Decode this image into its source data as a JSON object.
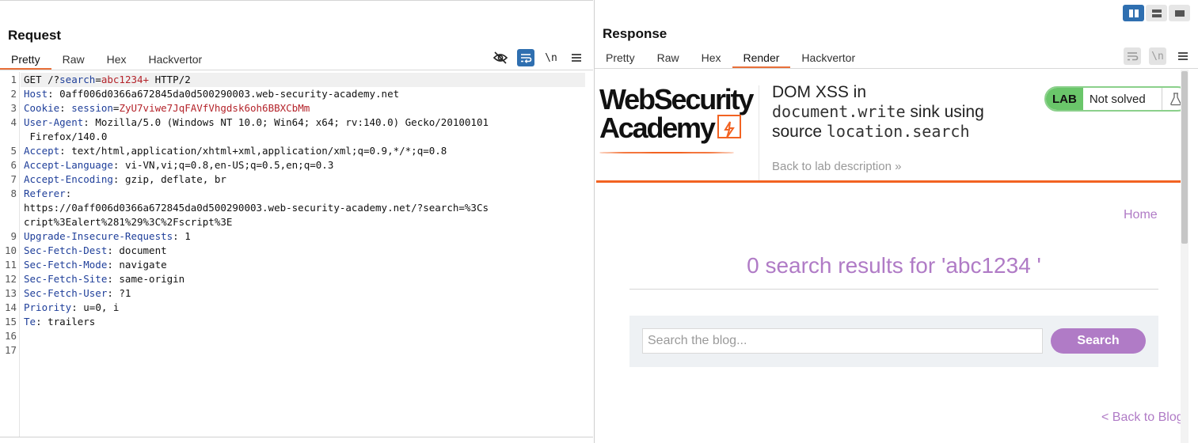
{
  "request": {
    "title": "Request",
    "tabs": [
      "Pretty",
      "Raw",
      "Hex",
      "Hackvertor"
    ],
    "active_tab": "Pretty",
    "toolbar": {
      "newline_label": "\\n"
    },
    "lines": [
      {
        "n": "1",
        "parts": [
          [
            "t",
            "GET /?"
          ],
          [
            "k",
            "search"
          ],
          [
            "t",
            "="
          ],
          [
            "v",
            "abc1234+"
          ],
          [
            "t",
            " HTTP/2"
          ]
        ]
      },
      {
        "n": "2",
        "parts": [
          [
            "k",
            "Host"
          ],
          [
            "t",
            ": 0aff006d0366a672845da0d500290003.web-security-academy.net"
          ]
        ]
      },
      {
        "n": "3",
        "parts": [
          [
            "k",
            "Cookie"
          ],
          [
            "t",
            ": "
          ],
          [
            "k",
            "session"
          ],
          [
            "t",
            "="
          ],
          [
            "v",
            "ZyU7viwe7JqFAVfVhgdsk6oh6BBXCbMm"
          ]
        ]
      },
      {
        "n": "4",
        "parts": [
          [
            "k",
            "User-Agent"
          ],
          [
            "t",
            ": Mozilla/5.0 (Windows NT 10.0; Win64; x64; rv:140.0) Gecko/20100101"
          ]
        ]
      },
      {
        "n": "",
        "parts": [
          [
            "t",
            " Firefox/140.0"
          ]
        ]
      },
      {
        "n": "5",
        "parts": [
          [
            "k",
            "Accept"
          ],
          [
            "t",
            ": text/html,application/xhtml+xml,application/xml;q=0.9,*/*;q=0.8"
          ]
        ]
      },
      {
        "n": "6",
        "parts": [
          [
            "k",
            "Accept-Language"
          ],
          [
            "t",
            ": vi-VN,vi;q=0.8,en-US;q=0.5,en;q=0.3"
          ]
        ]
      },
      {
        "n": "7",
        "parts": [
          [
            "k",
            "Accept-Encoding"
          ],
          [
            "t",
            ": gzip, deflate, br"
          ]
        ]
      },
      {
        "n": "8",
        "parts": [
          [
            "k",
            "Referer"
          ],
          [
            "t",
            ":"
          ]
        ]
      },
      {
        "n": "",
        "parts": [
          [
            "t",
            "https://0aff006d0366a672845da0d500290003.web-security-academy.net/?search=%3Cs"
          ]
        ]
      },
      {
        "n": "",
        "parts": [
          [
            "t",
            "cript%3Ealert%281%29%3C%2Fscript%3E"
          ]
        ]
      },
      {
        "n": "9",
        "parts": [
          [
            "k",
            "Upgrade-Insecure-Requests"
          ],
          [
            "t",
            ": 1"
          ]
        ]
      },
      {
        "n": "10",
        "parts": [
          [
            "k",
            "Sec-Fetch-Dest"
          ],
          [
            "t",
            ": document"
          ]
        ]
      },
      {
        "n": "11",
        "parts": [
          [
            "k",
            "Sec-Fetch-Mode"
          ],
          [
            "t",
            ": navigate"
          ]
        ]
      },
      {
        "n": "12",
        "parts": [
          [
            "k",
            "Sec-Fetch-Site"
          ],
          [
            "t",
            ": same-origin"
          ]
        ]
      },
      {
        "n": "13",
        "parts": [
          [
            "k",
            "Sec-Fetch-User"
          ],
          [
            "t",
            ": ?1"
          ]
        ]
      },
      {
        "n": "14",
        "parts": [
          [
            "k",
            "Priority"
          ],
          [
            "t",
            ": u=0, i"
          ]
        ]
      },
      {
        "n": "15",
        "parts": [
          [
            "k",
            "Te"
          ],
          [
            "t",
            ": trailers"
          ]
        ]
      },
      {
        "n": "16",
        "parts": []
      },
      {
        "n": "17",
        "parts": []
      }
    ]
  },
  "response": {
    "title": "Response",
    "tabs": [
      "Pretty",
      "Raw",
      "Hex",
      "Render",
      "Hackvertor"
    ],
    "active_tab": "Render",
    "toolbar": {
      "newline_label": "\\n"
    },
    "page": {
      "logo_line1": "WebSecurity",
      "logo_line2": "Academy",
      "lab_title_1": "DOM XSS in",
      "lab_title_code1": "document.write",
      "lab_title_2": " sink using",
      "lab_title_3": "source ",
      "lab_title_code2": "location.search",
      "back_to_description": "Back to lab description »",
      "lab_badge": "LAB",
      "lab_status": "Not solved",
      "home_link": "Home",
      "search_results": "0 search results for 'abc1234 '",
      "search_placeholder": "Search the blog...",
      "search_button": "Search",
      "back_to_blog": "< Back to Blog"
    }
  },
  "colors": {
    "accent_blue": "#2f6fb0",
    "burp_orange": "#e8703a",
    "wsa_orange": "#f26322",
    "wsa_purple": "#b07bc6",
    "lab_green": "#6ac66a"
  }
}
